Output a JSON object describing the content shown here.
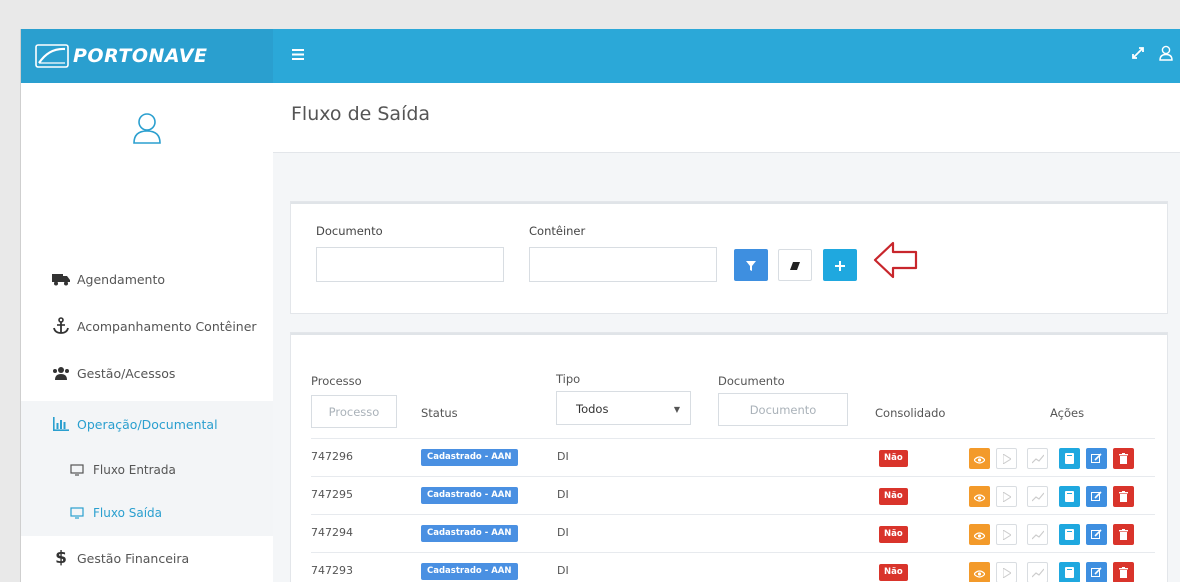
{
  "brand": {
    "name": "PORTONAVE"
  },
  "icons": {
    "menu": "hamburger-icon",
    "expand": "expand-icon",
    "user": "user-icon"
  },
  "colors": {
    "topbar": "#2ba8d8",
    "accent": "#2a9fcf",
    "status_badge": "#4a90e2",
    "danger": "#d9342b",
    "warning": "#f39a2a"
  },
  "sidebar": {
    "items": [
      {
        "label": "Agendamento",
        "icon": "truck-icon"
      },
      {
        "label": "Acompanhamento Contêiner",
        "icon": "anchor-icon"
      },
      {
        "label": "Gestão/Acessos",
        "icon": "users-icon"
      },
      {
        "label": "Operação/Documental",
        "icon": "bar-chart-icon"
      },
      {
        "label": "Fluxo Entrada",
        "icon": "monitor-icon"
      },
      {
        "label": "Fluxo Saída",
        "icon": "monitor-icon"
      },
      {
        "label": "Gestão Financeira",
        "icon": "dollar-icon"
      }
    ]
  },
  "page": {
    "title": "Fluxo de Saída"
  },
  "filter": {
    "documento_label": "Documento",
    "conteiner_label": "Contêiner",
    "documento_value": "",
    "conteiner_value": ""
  },
  "table": {
    "headers": {
      "processo": "Processo",
      "status": "Status",
      "tipo": "Tipo",
      "documento": "Documento",
      "consolidado": "Consolidado",
      "acoes": "Ações"
    },
    "filters": {
      "processo_placeholder": "Processo",
      "tipo_selected": "Todos",
      "documento_placeholder": "Documento"
    },
    "rows": [
      {
        "processo": "747296",
        "status": "Cadastrado - AAN",
        "tipo": "DI",
        "consolidado": "Não"
      },
      {
        "processo": "747295",
        "status": "Cadastrado - AAN",
        "tipo": "DI",
        "consolidado": "Não"
      },
      {
        "processo": "747294",
        "status": "Cadastrado - AAN",
        "tipo": "DI",
        "consolidado": "Não"
      },
      {
        "processo": "747293",
        "status": "Cadastrado - AAN",
        "tipo": "DI",
        "consolidado": "Não"
      }
    ]
  }
}
